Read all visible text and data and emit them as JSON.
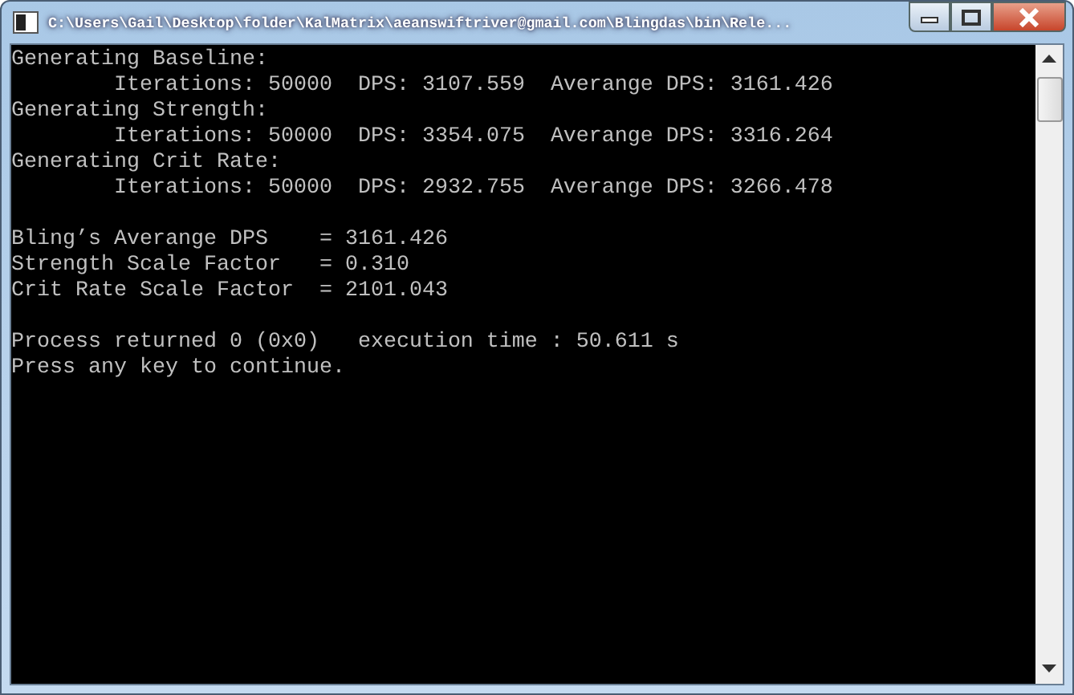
{
  "window": {
    "title": "C:\\Users\\Gail\\Desktop\\folder\\KalMatrix\\aeanswiftriver@gmail.com\\Blingdas\\bin\\Rele..."
  },
  "console": {
    "blocks": [
      [
        {
          "text": "Generating Baseline:",
          "indent": false
        },
        {
          "text": "Iterations: 50000  DPS: 3107.559  Averange DPS: 3161.426",
          "indent": true
        },
        {
          "text": "Generating Strength:",
          "indent": false
        },
        {
          "text": "Iterations: 50000  DPS: 3354.075  Averange DPS: 3316.264",
          "indent": true
        },
        {
          "text": "Generating Crit Rate:",
          "indent": false
        },
        {
          "text": "Iterations: 50000  DPS: 2932.755  Averange DPS: 3266.478",
          "indent": true
        }
      ],
      [
        {
          "text": "Bling’s Averange DPS    = 3161.426",
          "indent": false
        },
        {
          "text": "Strength Scale Factor   = 0.310",
          "indent": false
        },
        {
          "text": "Crit Rate Scale Factor  = 2101.043",
          "indent": false
        }
      ],
      [
        {
          "text": "Process returned 0 (0x0)   execution time : 50.611 s",
          "indent": false
        },
        {
          "text": "Press any key to continue.",
          "indent": false
        }
      ]
    ]
  }
}
